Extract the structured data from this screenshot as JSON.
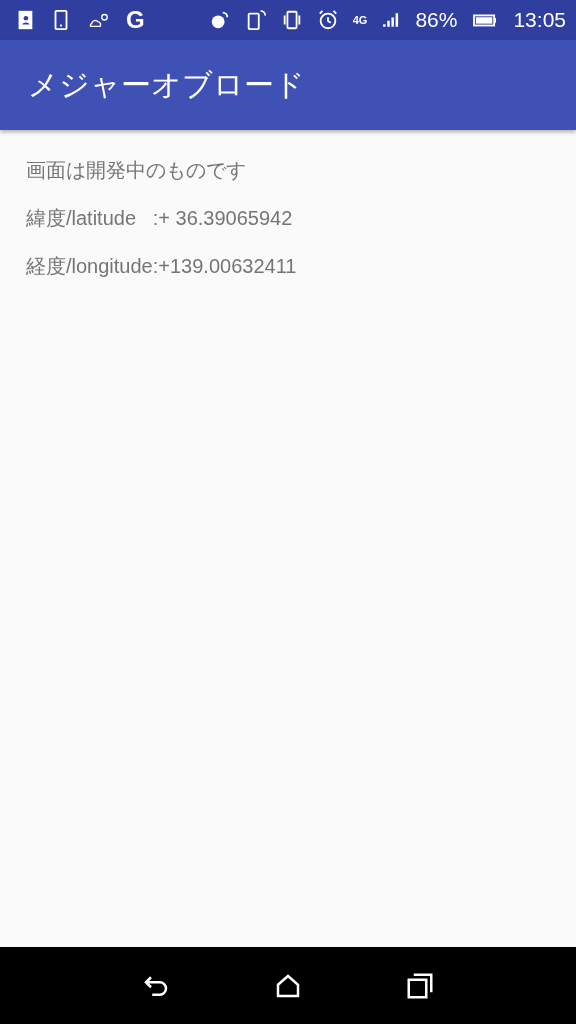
{
  "status_bar": {
    "app_badge": "G",
    "network": "4G",
    "battery": "86%",
    "time": "13:05"
  },
  "app_bar": {
    "title": "メジャーオブロード"
  },
  "lines": [
    {
      "text": "画面は開発中のものです"
    },
    {
      "text": "緯度/latitude   :+ 36.39065942"
    },
    {
      "text": "経度/longitude:+139.00632411"
    }
  ]
}
